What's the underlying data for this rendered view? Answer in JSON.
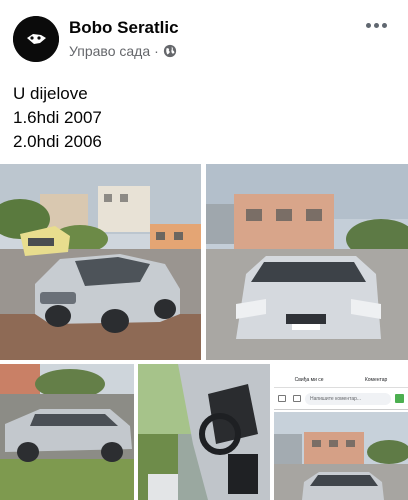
{
  "post": {
    "author": "Bobo Seratlic",
    "timestamp": "Управо сада",
    "privacy_icon": "globe-icon",
    "more_icon": "more-horizontal-icon",
    "lines": [
      "U dijelove",
      "1.6hdi 2007",
      "2.0hdi 2006"
    ]
  },
  "photos": [
    {
      "id": "photo-1",
      "subject": "silver Peugeot 407 sedan front"
    },
    {
      "id": "photo-2",
      "subject": "silver Peugeot 407 front view"
    },
    {
      "id": "photo-3",
      "subject": "silver Peugeot 407 SW side"
    },
    {
      "id": "photo-4",
      "subject": "car interior steering wheel"
    },
    {
      "id": "photo-5",
      "subject": "facebook screenshot of car photo"
    }
  ],
  "screenshot": {
    "tab_left": "Свиђа ми се",
    "tab_right": "Коментар",
    "search_placeholder": "Напишите коментар..."
  },
  "colors": {
    "text": "#050505",
    "secondary": "#65676b",
    "sky": "#c9d3dc",
    "car_silver": "#c7ccd1"
  }
}
